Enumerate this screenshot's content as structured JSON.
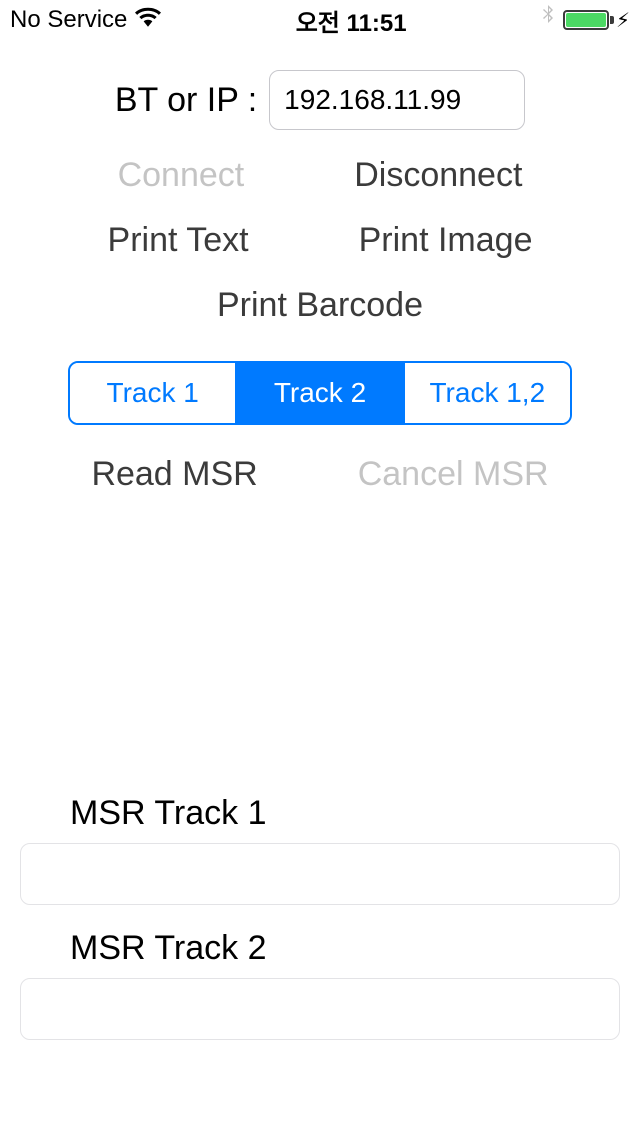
{
  "status_bar": {
    "service": "No Service",
    "time": "오전 11:51"
  },
  "ip_section": {
    "label": "BT or IP :",
    "value": "192.168.11.99"
  },
  "buttons": {
    "connect": "Connect",
    "disconnect": "Disconnect",
    "print_text": "Print Text",
    "print_image": "Print Image",
    "print_barcode": "Print Barcode",
    "read_msr": "Read MSR",
    "cancel_msr": "Cancel MSR"
  },
  "segmented": {
    "track1": "Track 1",
    "track2": "Track 2",
    "track12": "Track 1,2"
  },
  "msr": {
    "track1_label": "MSR Track 1",
    "track1_value": "",
    "track2_label": "MSR Track 2",
    "track2_value": ""
  }
}
